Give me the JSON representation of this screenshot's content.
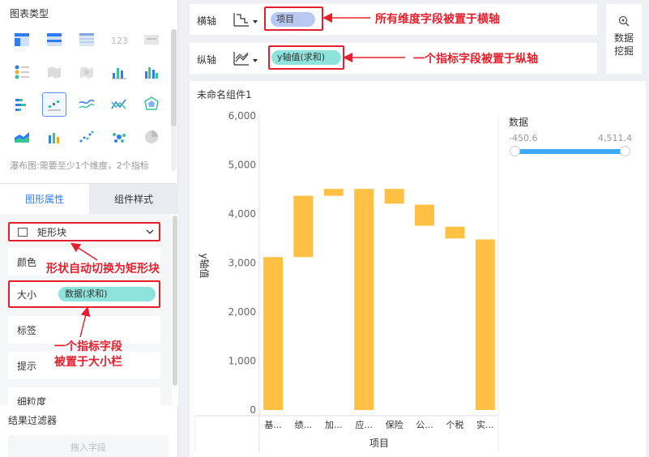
{
  "left_panel": {
    "chart_type_title": "图表类型",
    "chart_type_hint": "瀑布图:需要至少1个维度，2个指标",
    "tabs": [
      {
        "label": "图形属性",
        "active": true
      },
      {
        "label": "组件样式",
        "active": false
      }
    ],
    "shape_select": "矩形块",
    "prop_rows": {
      "color": "颜色",
      "size": "大小",
      "label": "标签",
      "tooltip": "提示",
      "granularity": "细粒度"
    },
    "size_field": "数据(求和)",
    "filter_title": "结果过滤器",
    "filter_placeholder": "拖入字段"
  },
  "x_axis": {
    "label": "横轴",
    "field": "项目"
  },
  "y_axis": {
    "label": "纵轴",
    "field": "y轴值(求和)"
  },
  "data_mining": "数据\n挖掘",
  "widget_title": "未命名组件1",
  "legend": {
    "title": "数据",
    "min": "-450.6",
    "max": "4,511.4"
  },
  "annotations": {
    "x_axis": "所有维度字段被置于横轴",
    "y_axis": "一个指标字段被置于纵轴",
    "shape": "形状自动切换为矩形块",
    "size_line1": "一个指标字段",
    "size_line2": "被置于大小栏"
  },
  "colors": {
    "bar": "#ffc043",
    "accent": "#2f7cf6",
    "annotation": "#e5202e",
    "pill": "#8ee4dc",
    "x_pill": "#b8c8f0"
  },
  "chart_data": {
    "type": "bar",
    "subtype": "waterfall",
    "xlabel": "项目",
    "ylabel": "y轴值",
    "categories": [
      "基...",
      "绩...",
      "加...",
      "应...",
      "保险",
      "公...",
      "个税",
      "实..."
    ],
    "bars": [
      {
        "low": 0,
        "high": 3120
      },
      {
        "low": 3120,
        "high": 4370
      },
      {
        "low": 4370,
        "high": 4510
      },
      {
        "low": 0,
        "high": 4510
      },
      {
        "low": 4210,
        "high": 4510
      },
      {
        "low": 3760,
        "high": 4190
      },
      {
        "low": 3500,
        "high": 3740
      },
      {
        "low": 0,
        "high": 3480
      }
    ],
    "yticks": [
      "0",
      "1,000",
      "2,000",
      "3,000",
      "4,000",
      "5,000",
      "6,000"
    ],
    "ylim": [
      0,
      6000
    ]
  }
}
